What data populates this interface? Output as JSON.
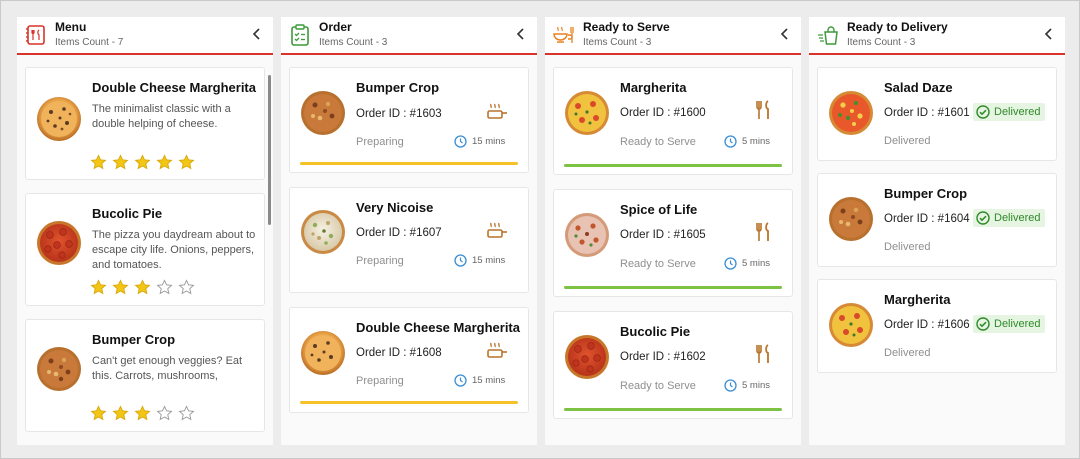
{
  "colors": {
    "accent": "#d9342b",
    "order_bar": "#f6c228",
    "ready_bar": "#7dc242",
    "delivered_green": "#2f8a2a",
    "star_gold": "#f3c615",
    "clock_blue": "#3b8fd6",
    "pan_brown": "#b8742a"
  },
  "columns": [
    {
      "title": "Menu",
      "count_label": "Items Count - 7",
      "icon": "menu-book-icon"
    },
    {
      "title": "Order",
      "count_label": "Items Count - 3",
      "icon": "clipboard-check-icon"
    },
    {
      "title": "Ready to Serve",
      "count_label": "Items Count - 3",
      "icon": "serving-icon"
    },
    {
      "title": "Ready to Delivery",
      "count_label": "Items Count - 3",
      "icon": "delivery-bag-icon"
    }
  ],
  "menu": [
    {
      "name": "Double Cheese Margherita",
      "desc": "The minimalist classic with a double helping of cheese.",
      "rating": 5
    },
    {
      "name": "Bucolic Pie",
      "desc": "The pizza you daydream about to escape city life. Onions, peppers, and tomatoes.",
      "rating": 3
    },
    {
      "name": "Bumper Crop",
      "desc": "Can't get enough veggies? Eat this. Carrots, mushrooms, potatoes, and way more.",
      "rating": 3
    }
  ],
  "orders": [
    {
      "name": "Bumper Crop",
      "order_id": "Order ID : #1603",
      "status": "Preparing",
      "time": "15 mins"
    },
    {
      "name": "Very Nicoise",
      "order_id": "Order ID : #1607",
      "status": "Preparing",
      "time": "15 mins"
    },
    {
      "name": "Double Cheese Margherita",
      "order_id": "Order ID : #1608",
      "status": "Preparing",
      "time": "15 mins"
    }
  ],
  "ready": [
    {
      "name": "Margherita",
      "order_id": "Order ID : #1600",
      "status": "Ready to Serve",
      "time": "5 mins"
    },
    {
      "name": "Spice of Life",
      "order_id": "Order ID : #1605",
      "status": "Ready to Serve",
      "time": "5 mins"
    },
    {
      "name": "Bucolic Pie",
      "order_id": "Order ID : #1602",
      "status": "Ready to Serve",
      "time": "5 mins"
    }
  ],
  "delivery": [
    {
      "name": "Salad Daze",
      "order_id": "Order ID : #1601",
      "badge": "Delivered",
      "status": "Delivered"
    },
    {
      "name": "Bumper Crop",
      "order_id": "Order ID : #1604",
      "badge": "Delivered",
      "status": "Delivered"
    },
    {
      "name": "Margherita",
      "order_id": "Order ID : #1606",
      "badge": "Delivered",
      "status": "Delivered"
    }
  ]
}
